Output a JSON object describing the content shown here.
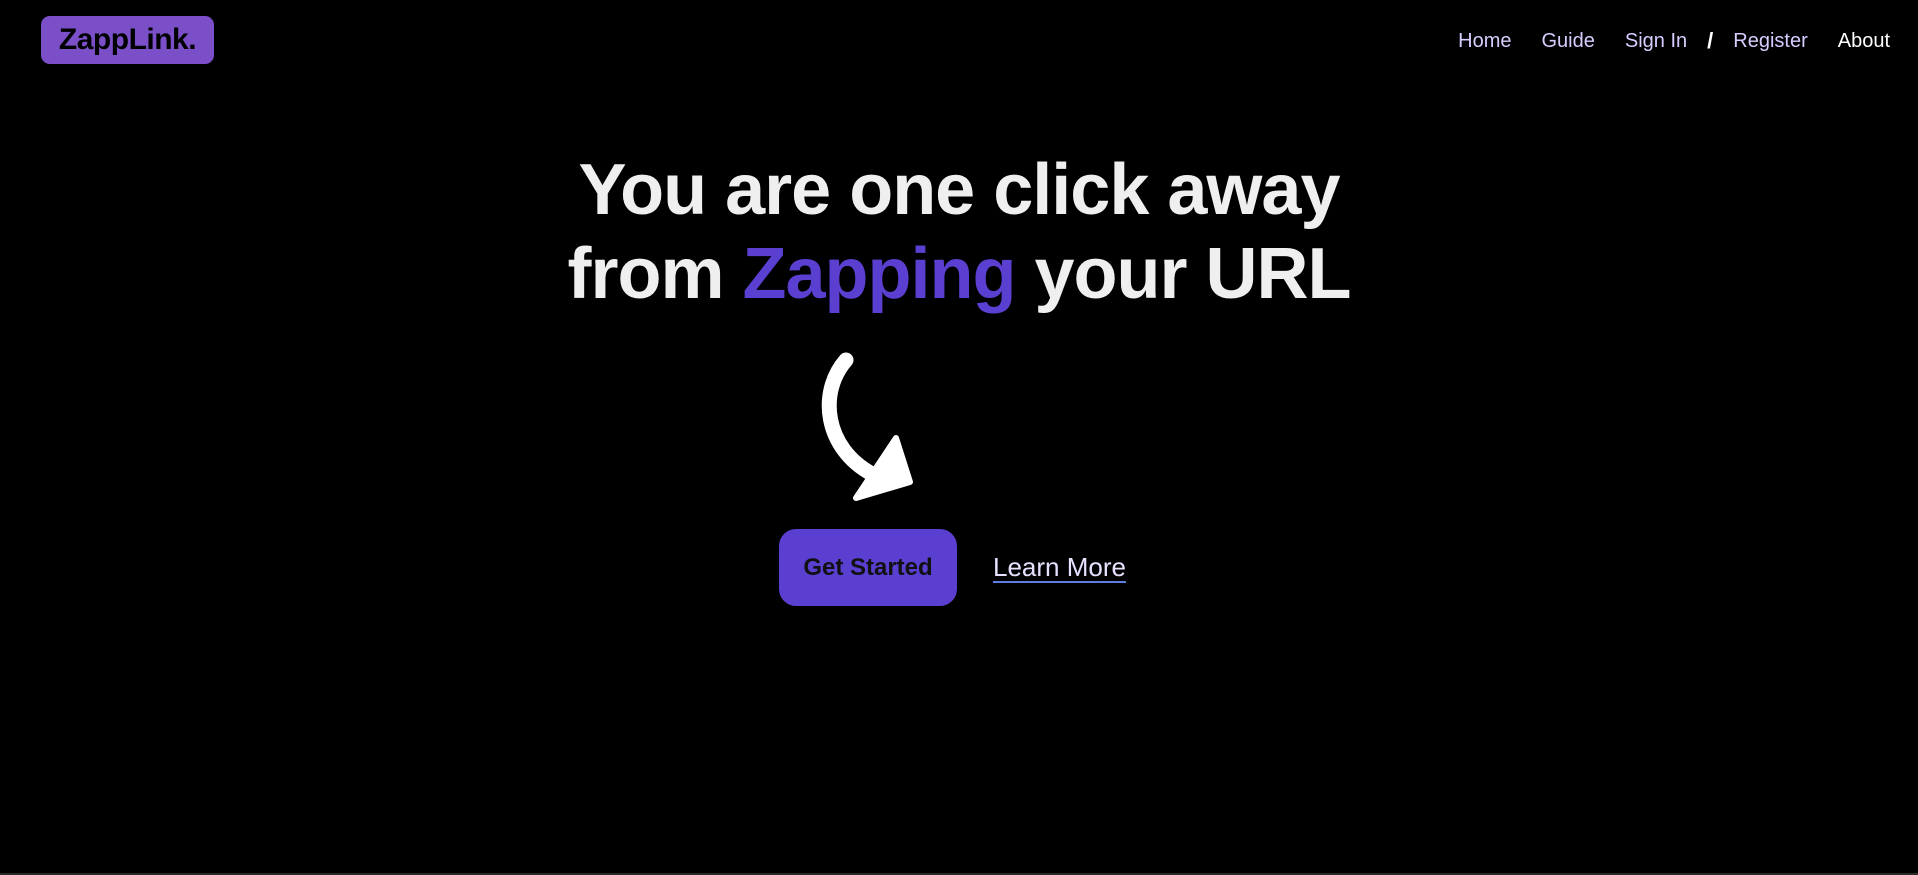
{
  "brand": {
    "logo_text": "ZappLink."
  },
  "nav": {
    "home": "Home",
    "guide": "Guide",
    "sign_in": "Sign In",
    "separator": "/",
    "register": "Register",
    "about": "About"
  },
  "hero": {
    "line1": "You are one click away",
    "line2_prefix": "from",
    "line2_accent": "Zapping",
    "line2_suffix": "your URL",
    "cta_label": "Get Started",
    "secondary_label": "Learn More"
  },
  "colors": {
    "background": "#000000",
    "accent": "#5b3fd1",
    "logo_bg": "#7b4fc7",
    "nav_link": "#d9ccff"
  },
  "icons": {
    "arrow": "curved-arrow-down-right-icon"
  }
}
